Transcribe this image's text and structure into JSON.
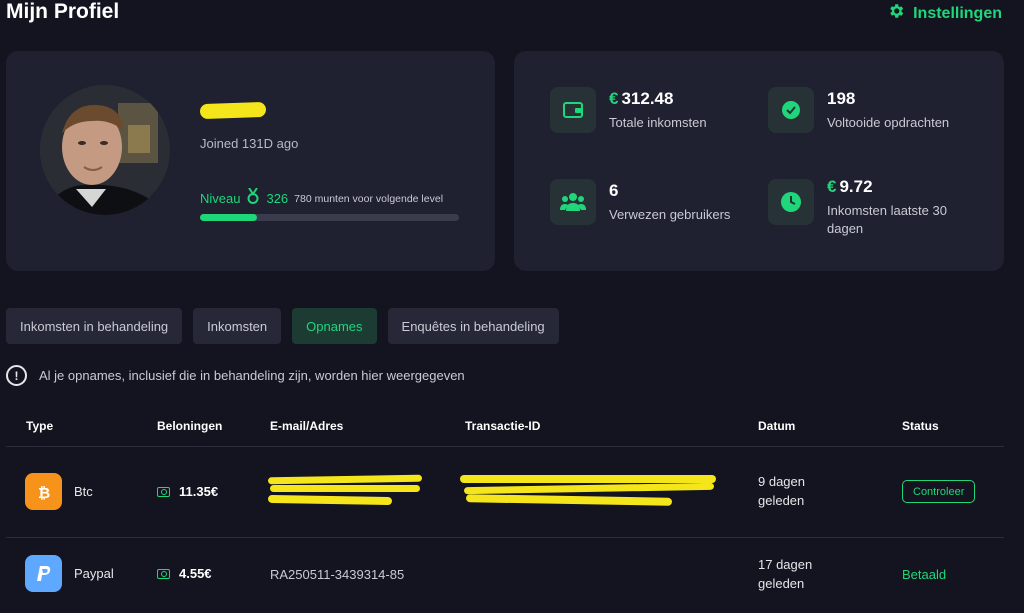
{
  "header": {
    "title": "Mijn Profiel",
    "settings_label": "Instellingen"
  },
  "profile": {
    "joined": "Joined 131D ago",
    "level_label": "Niveau",
    "level_points": "326",
    "level_next": "780 munten voor volgende level",
    "level_progress": 0.22
  },
  "stats": [
    {
      "currency": "€",
      "value": "312.48",
      "label": "Totale inkomsten",
      "icon": "wallet-icon"
    },
    {
      "currency": "",
      "value": "198",
      "label": "Voltooide opdrachten",
      "icon": "check-badge-icon"
    },
    {
      "currency": "",
      "value": "6",
      "label": "Verwezen gebruikers",
      "icon": "users-icon"
    },
    {
      "currency": "€",
      "value": "9.72",
      "label": "Inkomsten laatste 30 dagen",
      "icon": "clock-icon"
    }
  ],
  "tabs": [
    {
      "label": "Inkomsten in behandeling",
      "active": false
    },
    {
      "label": "Inkomsten",
      "active": false
    },
    {
      "label": "Opnames",
      "active": true
    },
    {
      "label": "Enquêtes in behandeling",
      "active": false
    }
  ],
  "info_text": "Al je opnames, inclusief die in behandeling zijn, worden hier weergegeven",
  "table": {
    "headers": [
      "Type",
      "Beloningen",
      "E-mail/Adres",
      "Transactie-ID",
      "Datum",
      "Status"
    ],
    "rows": [
      {
        "type": "Btc",
        "reward": "11.35€",
        "address": "",
        "txid": "",
        "date": "9 dagen geleden",
        "status": "Controleer",
        "status_style": "button"
      },
      {
        "type": "Paypal",
        "reward": "4.55€",
        "address": "RA250511-3439314-85",
        "txid": "",
        "date": "17 dagen geleden",
        "status": "Betaald",
        "status_style": "text"
      }
    ]
  },
  "colors": {
    "accent": "#1fd67a",
    "background": "#13141f",
    "card": "#1f2030",
    "btc": "#f7931a",
    "paypal": "#5fa8ff"
  }
}
